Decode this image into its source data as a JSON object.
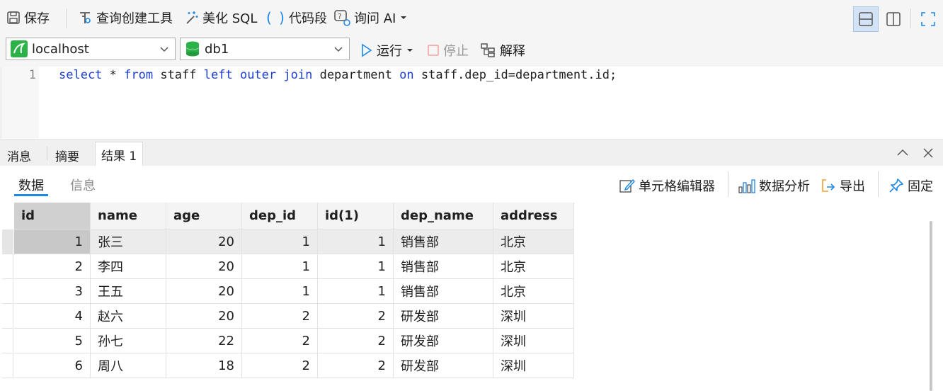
{
  "toolbar": {
    "save": "保存",
    "query_builder": "查询创建工具",
    "beautify": "美化 SQL",
    "snippet": "代码段",
    "ask_ai": "询问 AI"
  },
  "connection": {
    "server": "localhost",
    "database": "db1",
    "run": "运行",
    "stop": "停止",
    "explain": "解释"
  },
  "editor": {
    "line_number": "1",
    "tokens": [
      "select",
      " * ",
      "from",
      " staff ",
      "left",
      " ",
      "outer",
      " ",
      "join",
      " department ",
      "on",
      " staff.dep_id=department.id;"
    ]
  },
  "result_tabs": [
    "消息",
    "摘要",
    "结果 1"
  ],
  "sub_tabs": [
    "数据",
    "信息"
  ],
  "actions": {
    "cell_editor": "单元格编辑器",
    "data_analysis": "数据分析",
    "export": "导出",
    "pin": "固定"
  },
  "table": {
    "columns": [
      "id",
      "name",
      "age",
      "dep_id",
      "id(1)",
      "dep_name",
      "address"
    ],
    "rows": [
      [
        "1",
        "张三",
        "20",
        "1",
        "1",
        "销售部",
        "北京"
      ],
      [
        "2",
        "李四",
        "20",
        "1",
        "1",
        "销售部",
        "北京"
      ],
      [
        "3",
        "王五",
        "20",
        "1",
        "1",
        "销售部",
        "北京"
      ],
      [
        "4",
        "赵六",
        "20",
        "2",
        "2",
        "研发部",
        "深圳"
      ],
      [
        "5",
        "孙七",
        "22",
        "2",
        "2",
        "研发部",
        "深圳"
      ],
      [
        "6",
        "周八",
        "18",
        "2",
        "2",
        "研发部",
        "深圳"
      ]
    ]
  },
  "colors": {
    "keyword": "#1a3fd6",
    "accent": "#1e88e5",
    "selected_row": "#ececec",
    "selected_cell": "#c8c8c8"
  }
}
